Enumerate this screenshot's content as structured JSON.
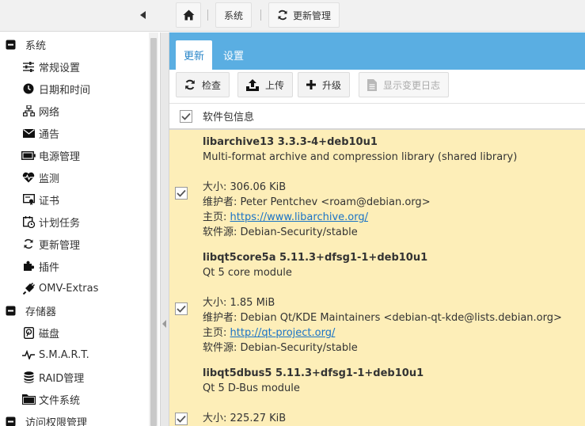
{
  "breadcrumb": {
    "system": "系统",
    "update_management": "更新管理"
  },
  "sidebar": {
    "items": [
      {
        "label": "系统",
        "icon": "minus-square-icon",
        "group": true
      },
      {
        "label": "常规设置",
        "icon": "sliders-icon"
      },
      {
        "label": "日期和时间",
        "icon": "clock-icon"
      },
      {
        "label": "网络",
        "icon": "network-icon"
      },
      {
        "label": "通告",
        "icon": "envelope-icon"
      },
      {
        "label": "电源管理",
        "icon": "battery-icon"
      },
      {
        "label": "监测",
        "icon": "heartbeat-icon"
      },
      {
        "label": "证书",
        "icon": "certificate-icon"
      },
      {
        "label": "计划任务",
        "icon": "calendar-clock-icon"
      },
      {
        "label": "更新管理",
        "icon": "sync-icon"
      },
      {
        "label": "插件",
        "icon": "puzzle-icon"
      },
      {
        "label": "OMV-Extras",
        "icon": "plug-icon"
      },
      {
        "label": "存储器",
        "icon": "minus-square-icon",
        "group": true
      },
      {
        "label": "磁盘",
        "icon": "hdd-icon"
      },
      {
        "label": "S.M.A.R.T.",
        "icon": "pulse-icon"
      },
      {
        "label": "RAID管理",
        "icon": "database-icon"
      },
      {
        "label": "文件系统",
        "icon": "folder-icon"
      },
      {
        "label": "访问权限管理",
        "icon": "minus-square-icon",
        "group": true
      }
    ]
  },
  "tabs": {
    "update": "更新",
    "settings": "设置"
  },
  "toolbar": {
    "check": "检查",
    "upload": "上传",
    "upgrade": "升级",
    "changelog": "显示变更日志"
  },
  "grid": {
    "header": "软件包信息",
    "rows": [
      {
        "name": "libarchive13 3.3.3-4+deb10u1",
        "summary": "Multi-format archive and compression library (shared library)",
        "size": "大小: 306.06 KiB",
        "maintainer": "维护者: Peter Pentchev <roam@debian.org>",
        "homepage_label": "主页: ",
        "homepage_url": "https://www.libarchive.org/",
        "source": "软件源: Debian-Security/stable"
      },
      {
        "name": "libqt5core5a 5.11.3+dfsg1-1+deb10u1",
        "summary": "Qt 5 core module",
        "size": "大小: 1.85 MiB",
        "maintainer": "维护者: Debian Qt/KDE Maintainers <debian-qt-kde@lists.debian.org>",
        "homepage_label": "主页: ",
        "homepage_url": "http://qt-project.org/",
        "source": "软件源: Debian-Security/stable"
      },
      {
        "name": "libqt5dbus5 5.11.3+dfsg1-1+deb10u1",
        "summary": "Qt 5 D-Bus module",
        "size": "大小: 225.27 KiB"
      }
    ]
  },
  "colors": {
    "accent": "#5aaee2",
    "row_highlight": "#fdeeb8",
    "link": "#1a73c6"
  }
}
